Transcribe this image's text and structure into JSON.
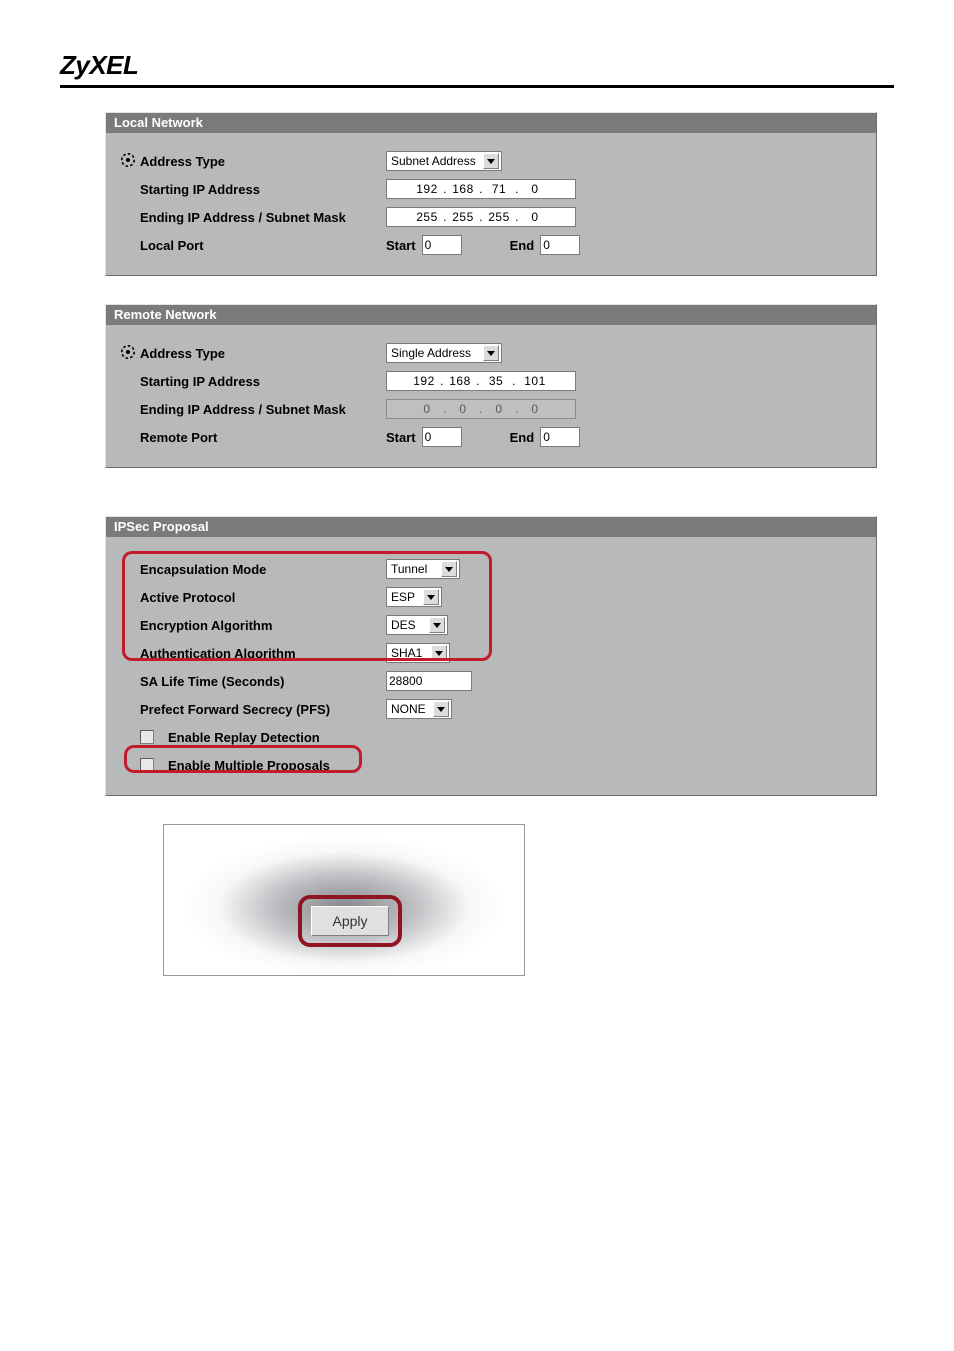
{
  "brand": "ZyXEL",
  "local": {
    "title": "Local Network",
    "addr_type_label": "Address Type",
    "addr_type_value": "Subnet Address",
    "starting_label": "Starting IP Address",
    "starting_value": "192.168.71.0",
    "starting_oct": [
      "192",
      "168",
      "71",
      "0"
    ],
    "ending_label": "Ending IP Address / Subnet Mask",
    "ending_value": "255.255.255.0",
    "ending_oct": [
      "255",
      "255",
      "255",
      "0"
    ],
    "port_label": "Local Port",
    "port_start_label": "Start",
    "port_start_value": "0",
    "port_end_label": "End",
    "port_end_value": "0"
  },
  "remote": {
    "title": "Remote Network",
    "addr_type_label": "Address Type",
    "addr_type_value": "Single Address",
    "starting_label": "Starting IP Address",
    "starting_value": "192.168.35.101",
    "starting_oct": [
      "192",
      "168",
      "35",
      "101"
    ],
    "ending_label": "Ending IP Address / Subnet Mask",
    "ending_value": "0.0.0.0",
    "ending_oct": [
      "0",
      "0",
      "0",
      "0"
    ],
    "port_label": "Remote Port",
    "port_start_label": "Start",
    "port_start_value": "0",
    "port_end_label": "End",
    "port_end_value": "0"
  },
  "ipsec": {
    "title": "IPSec Proposal",
    "encaps_label": "Encapsulation Mode",
    "encaps_value": "Tunnel",
    "proto_label": "Active Protocol",
    "proto_value": "ESP",
    "enc_label": "Encryption Algorithm",
    "enc_value": "DES",
    "auth_label": "Authentication Algorithm",
    "auth_value": "SHA1",
    "salife_label": "SA Life Time (Seconds)",
    "salife_value": "28800",
    "pfs_label": "Prefect Forward Secrecy (PFS)",
    "pfs_value": "NONE",
    "replay_label": "Enable Replay Detection",
    "multi_label": "Enable Multiple Proposals"
  },
  "buttons": {
    "apply": "Apply"
  }
}
